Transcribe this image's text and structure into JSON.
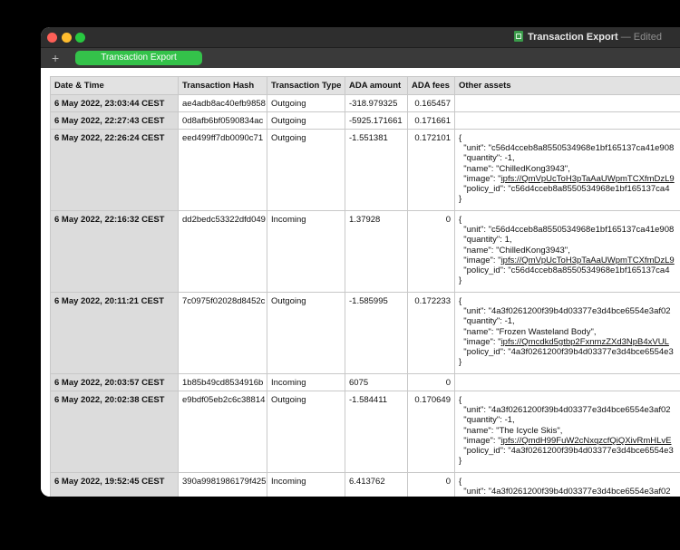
{
  "window": {
    "doc_title": "Transaction Export",
    "doc_status": "— Edited"
  },
  "tabs": {
    "add": "+",
    "sheet_tab": "Transaction Export"
  },
  "table": {
    "headers": [
      "Date & Time",
      "Transaction Hash",
      "Transaction Type",
      "ADA amount",
      "ADA fees",
      "Other assets"
    ],
    "rows": [
      {
        "date": "6 May 2022, 23:03:44 CEST",
        "hash": "ae4adb8ac40efb9858",
        "type": "Outgoing",
        "ada": "-318.979325",
        "fee": "0.165457",
        "assets": []
      },
      {
        "date": "6 May 2022, 22:27:43 CEST",
        "hash": "0d8afb6bf0590834ac",
        "type": "Outgoing",
        "ada": "-5925.171661",
        "fee": "0.171661",
        "assets": []
      },
      {
        "date": "6 May 2022, 22:26:24 CEST",
        "hash": "eed499ff7db0090c71",
        "type": "Outgoing",
        "ada": "-1.551381",
        "fee": "0.172101",
        "assets": [
          "{",
          "  \"unit\": \"c56d4cceb8a8550534968e1bf165137ca41e908",
          "  \"quantity\": -1,",
          "  \"name\": \"ChilledKong3943\",",
          "  \"image\": \"ipfs://QmVpUcToH3pTaAaUWpmTCXfmDzL9",
          "  \"policy_id\": \"c56d4cceb8a8550534968e1bf165137ca4",
          "}"
        ]
      },
      {
        "date": "6 May 2022, 22:16:32 CEST",
        "hash": "dd2bedc53322dfd049",
        "type": "Incoming",
        "ada": "1.37928",
        "fee": "0",
        "assets": [
          "{",
          "  \"unit\": \"c56d4cceb8a8550534968e1bf165137ca41e908",
          "  \"quantity\": 1,",
          "  \"name\": \"ChilledKong3943\",",
          "  \"image\": \"ipfs://QmVpUcToH3pTaAaUWpmTCXfmDzL9",
          "  \"policy_id\": \"c56d4cceb8a8550534968e1bf165137ca4",
          "}"
        ]
      },
      {
        "date": "6 May 2022, 20:11:21 CEST",
        "hash": "7c0975f02028d8452c",
        "type": "Outgoing",
        "ada": "-1.585995",
        "fee": "0.172233",
        "assets": [
          "{",
          "  \"unit\": \"4a3f0261200f39b4d03377e3d4bce6554e3af02",
          "  \"quantity\": -1,",
          "  \"name\": \"Frozen Wasteland Body\",",
          "  \"image\": \"ipfs://Qmcdkd5gtbp2FxnmzZXd3NpB4xVUL",
          "  \"policy_id\": \"4a3f0261200f39b4d03377e3d4bce6554e3",
          "}"
        ]
      },
      {
        "date": "6 May 2022, 20:03:57 CEST",
        "hash": "1b85b49cd8534916b",
        "type": "Incoming",
        "ada": "6075",
        "fee": "0",
        "assets": []
      },
      {
        "date": "6 May 2022, 20:02:38 CEST",
        "hash": "e9bdf05eb2c6c38814",
        "type": "Outgoing",
        "ada": "-1.584411",
        "fee": "0.170649",
        "assets": [
          "{",
          "  \"unit\": \"4a3f0261200f39b4d03377e3d4bce6554e3af02",
          "  \"quantity\": -1,",
          "  \"name\": \"The Icycle Skis\",",
          "  \"image\": \"ipfs://QmdH99FuW2cNxqzcfQiQXivRmHLvE",
          "  \"policy_id\": \"4a3f0261200f39b4d03377e3d4bce6554e3",
          "}"
        ]
      },
      {
        "date": "6 May 2022, 19:52:45 CEST",
        "hash": "390a9981986179f425",
        "type": "Incoming",
        "ada": "6.413762",
        "fee": "0",
        "assets": [
          "{",
          "  \"unit\": \"4a3f0261200f39b4d03377e3d4bce6554e3af02"
        ]
      }
    ]
  }
}
